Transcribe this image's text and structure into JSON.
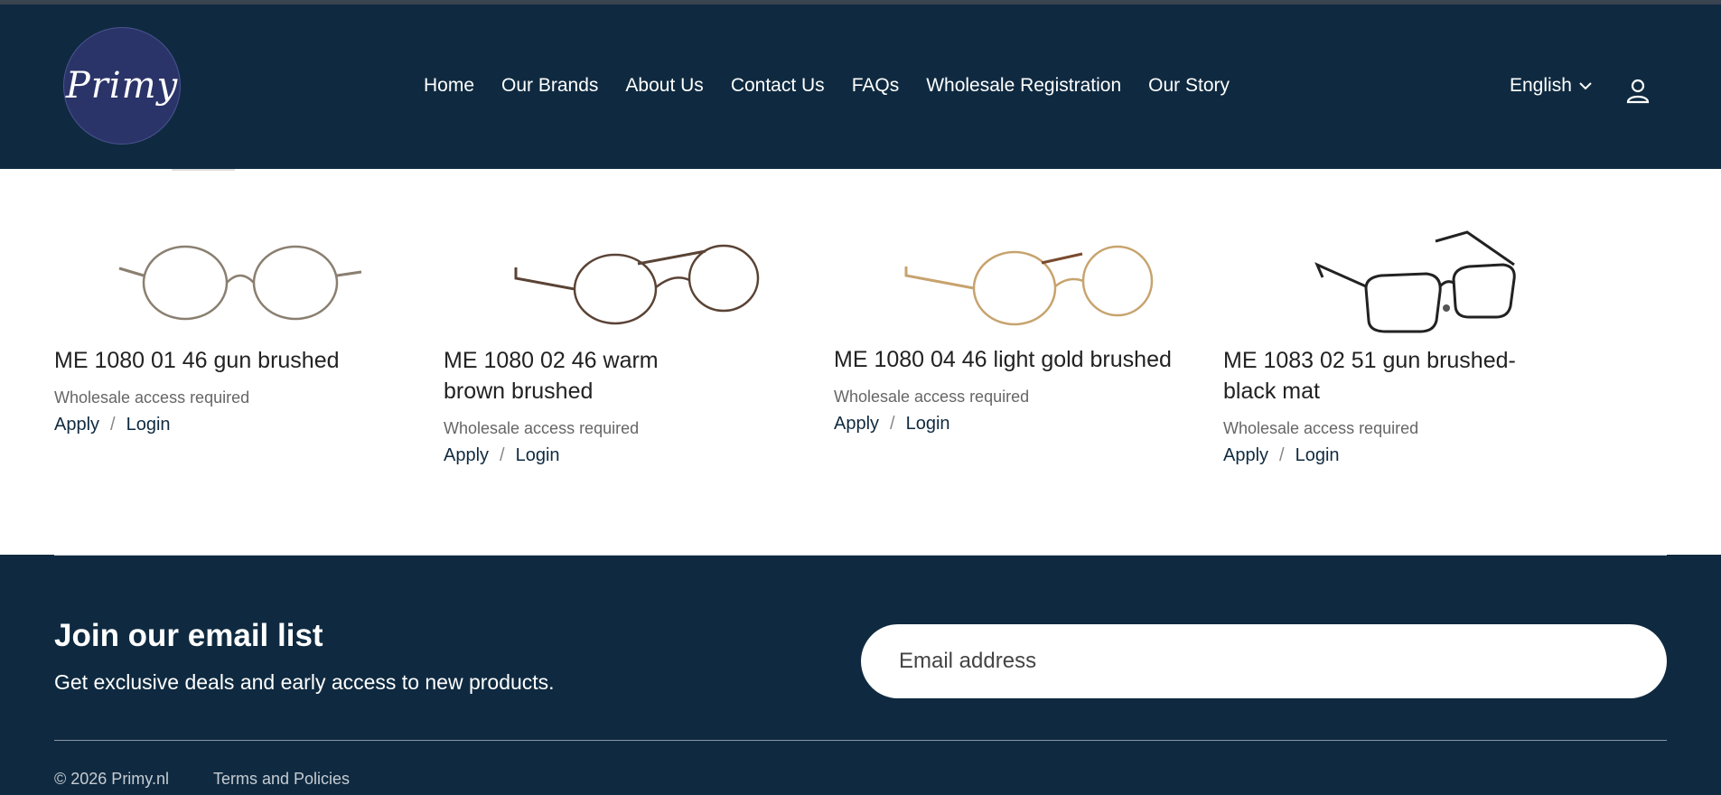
{
  "header": {
    "logo_text": "Primy",
    "nav": [
      "Home",
      "Our Brands",
      "About Us",
      "Contact Us",
      "FAQs",
      "Wholesale Registration",
      "Our Story"
    ],
    "language": "English",
    "user_icon": "user-icon"
  },
  "products": [
    {
      "name": "ME 1080 01 46 gun brushed",
      "access": "Wholesale access required",
      "apply": "Apply",
      "sep": "/",
      "login": "Login",
      "frame_color": "#8a7f70"
    },
    {
      "name": "ME 1080 02 46 warm brown brushed",
      "access": "Wholesale access required",
      "apply": "Apply",
      "sep": "/",
      "login": "Login",
      "frame_color": "#5a4335"
    },
    {
      "name": "ME 1080 04 46 light gold brushed",
      "access": "Wholesale access required",
      "apply": "Apply",
      "sep": "/",
      "login": "Login",
      "frame_color": "#c7a36e"
    },
    {
      "name": "ME 1083 02 51 gun brushed-black mat",
      "access": "Wholesale access required",
      "apply": "Apply",
      "sep": "/",
      "login": "Login",
      "frame_color": "#222222"
    }
  ],
  "footer": {
    "join_title": "Join our email list",
    "join_subtitle": "Get exclusive deals and early access to new products.",
    "email_placeholder": "Email address",
    "copyright": "© 2026 Primy.nl",
    "terms": "Terms and Policies"
  },
  "colors": {
    "header_bg": "#0f2a40",
    "logo_bg": "#2b3468",
    "link": "#0f2a40"
  }
}
